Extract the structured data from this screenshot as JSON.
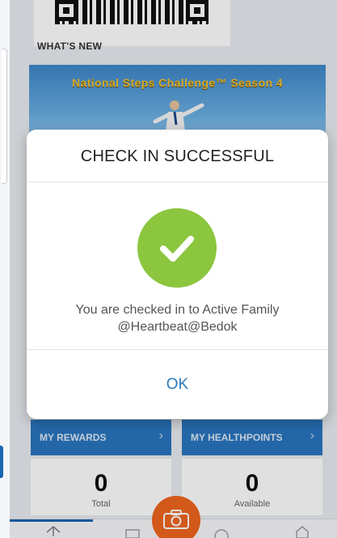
{
  "whats_new": {
    "heading": "WHAT'S NEW"
  },
  "banner": {
    "title": "National Steps Challenge™ Season 4"
  },
  "modal": {
    "title": "CHECK IN SUCCESSFUL",
    "message_line1": "You are checked in to Active Family",
    "message_line2": "@Heartbeat@Bedok",
    "ok_label": "OK",
    "success_color": "#8cc63f"
  },
  "tiles": {
    "rewards_label": "MY REWARDS",
    "healthpoints_label": "MY HEALTHPOINTS"
  },
  "stats": {
    "rewards_value": "0",
    "rewards_sub": "Total",
    "healthpoints_value": "0",
    "healthpoints_sub": "Available"
  },
  "icons": {
    "fab": "camera-icon",
    "success": "checkmark-icon",
    "chevron": "chevron-right-icon"
  },
  "colors": {
    "primary": "#2a76c0",
    "accent": "#f0661e",
    "link": "#2d7ab8"
  }
}
